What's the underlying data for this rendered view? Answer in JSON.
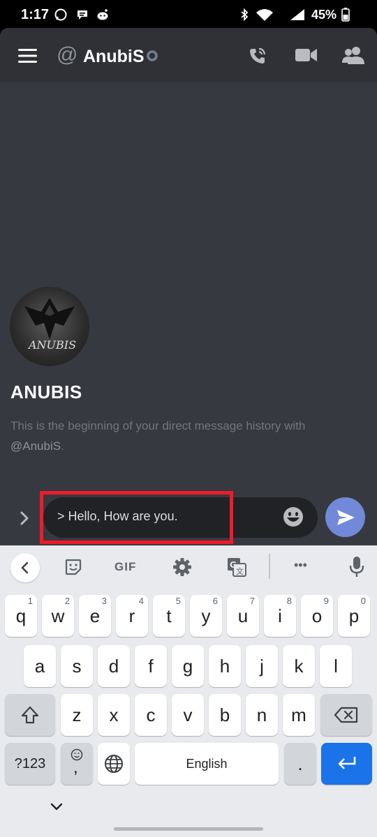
{
  "status_bar": {
    "time": "1:17",
    "battery_percent": "45%",
    "icons": [
      "whatsapp-icon",
      "messages-icon",
      "reddit-icon",
      "bluetooth-icon",
      "wifi-icon",
      "signal-icon",
      "battery-icon"
    ]
  },
  "header": {
    "at_symbol": "@",
    "title": "AnubiS",
    "icons": [
      "menu-icon",
      "call-icon",
      "video-icon",
      "members-icon"
    ]
  },
  "profile": {
    "avatar_text": "ANUBIS",
    "display_name": "ANUBIS",
    "intro_text": "This is the beginning of your direct message history with",
    "mention": "@AnubiS",
    "intro_end": "."
  },
  "composer": {
    "input_value": "> Hello, How are you.",
    "icons": [
      "expand-chevron-icon",
      "emoji-icon",
      "send-icon"
    ]
  },
  "keyboard": {
    "toolbar": {
      "gif_label": "GIF",
      "more_label": "•••",
      "icons": [
        "back-icon",
        "sticker-icon",
        "settings-icon",
        "translate-icon",
        "microphone-icon"
      ]
    },
    "row1": [
      {
        "key": "q",
        "hint": "1"
      },
      {
        "key": "w",
        "hint": "2"
      },
      {
        "key": "e",
        "hint": "3"
      },
      {
        "key": "r",
        "hint": "4"
      },
      {
        "key": "t",
        "hint": "5"
      },
      {
        "key": "y",
        "hint": "6"
      },
      {
        "key": "u",
        "hint": "7"
      },
      {
        "key": "i",
        "hint": "8"
      },
      {
        "key": "o",
        "hint": "9"
      },
      {
        "key": "p",
        "hint": "0"
      }
    ],
    "row2": [
      "a",
      "s",
      "d",
      "f",
      "g",
      "h",
      "j",
      "k",
      "l"
    ],
    "row3": [
      "z",
      "x",
      "c",
      "v",
      "b",
      "n",
      "m"
    ],
    "symbols_label": "?123",
    "comma_label": ",",
    "space_label": "English",
    "period_label": ".",
    "accent_color": "#1a73e8"
  },
  "colors": {
    "discord_background": "#36393f",
    "header_background": "#2f3136",
    "blurple": "#7289da",
    "highlight_red": "#f01a2a"
  }
}
